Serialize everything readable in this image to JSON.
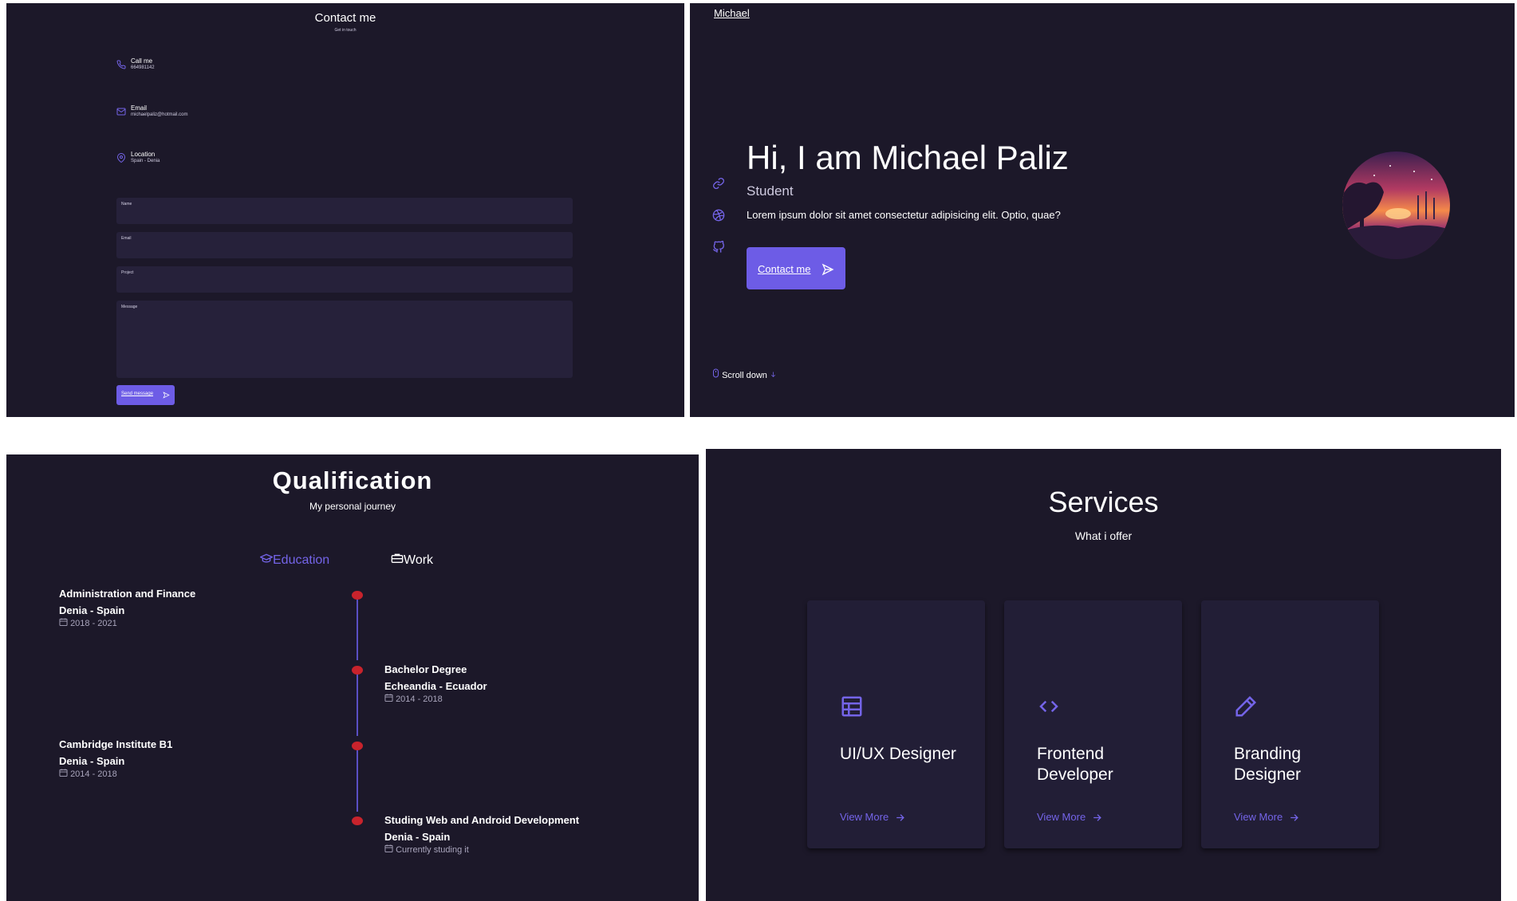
{
  "contact": {
    "title": "Contact me",
    "subtitle": "Get in touch",
    "info": [
      {
        "label": "Call me",
        "value": "664981142",
        "icon": "phone-icon"
      },
      {
        "label": "Email",
        "value": "michaelpaliz@hotmail.com",
        "icon": "mail-icon"
      },
      {
        "label": "Location",
        "value": "Spain - Denia",
        "icon": "map-pin-icon"
      }
    ],
    "fields": {
      "name": "Name",
      "email": "Email",
      "project": "Project",
      "message": "Message"
    },
    "send_label": "Send message"
  },
  "hero": {
    "logo": "Michael",
    "title": "Hi, I am Michael Paliz",
    "role": "Student",
    "description": "Lorem ipsum dolor sit amet consectetur adipisicing elit. Optio, quae?",
    "contact_label": "Contact me",
    "scroll_label": "Scroll down",
    "social_icons": [
      "link-icon",
      "dribbble-icon",
      "github-icon"
    ]
  },
  "qualification": {
    "title": "Qualification",
    "subtitle": "My personal journey",
    "tabs": {
      "education": "Education",
      "work": "Work"
    },
    "items": [
      {
        "title": "Administration and Finance",
        "location": "Denia - Spain",
        "dates": "2018 - 2021"
      },
      {
        "title": "Bachelor Degree",
        "location": "Echeandia - Ecuador",
        "dates": "2014 - 2018"
      },
      {
        "title": "Cambridge Institute B1",
        "location": "Denia - Spain",
        "dates": "2014 - 2018"
      },
      {
        "title": "Studing Web and Android Development",
        "location": "Denia - Spain",
        "dates": "Currently studing it"
      }
    ]
  },
  "services": {
    "title": "Services",
    "subtitle": "What i offer",
    "cards": [
      {
        "name": "UI/UX Designer",
        "more": "View More",
        "icon": "layout-icon"
      },
      {
        "name": "Frontend Developer",
        "more": "View More",
        "icon": "code-icon"
      },
      {
        "name": "Branding Designer",
        "more": "View More",
        "icon": "pencil-icon"
      }
    ]
  },
  "colors": {
    "background": "#1c1829",
    "accent": "#6d5ce6",
    "timeline_dot": "#c8232c"
  }
}
